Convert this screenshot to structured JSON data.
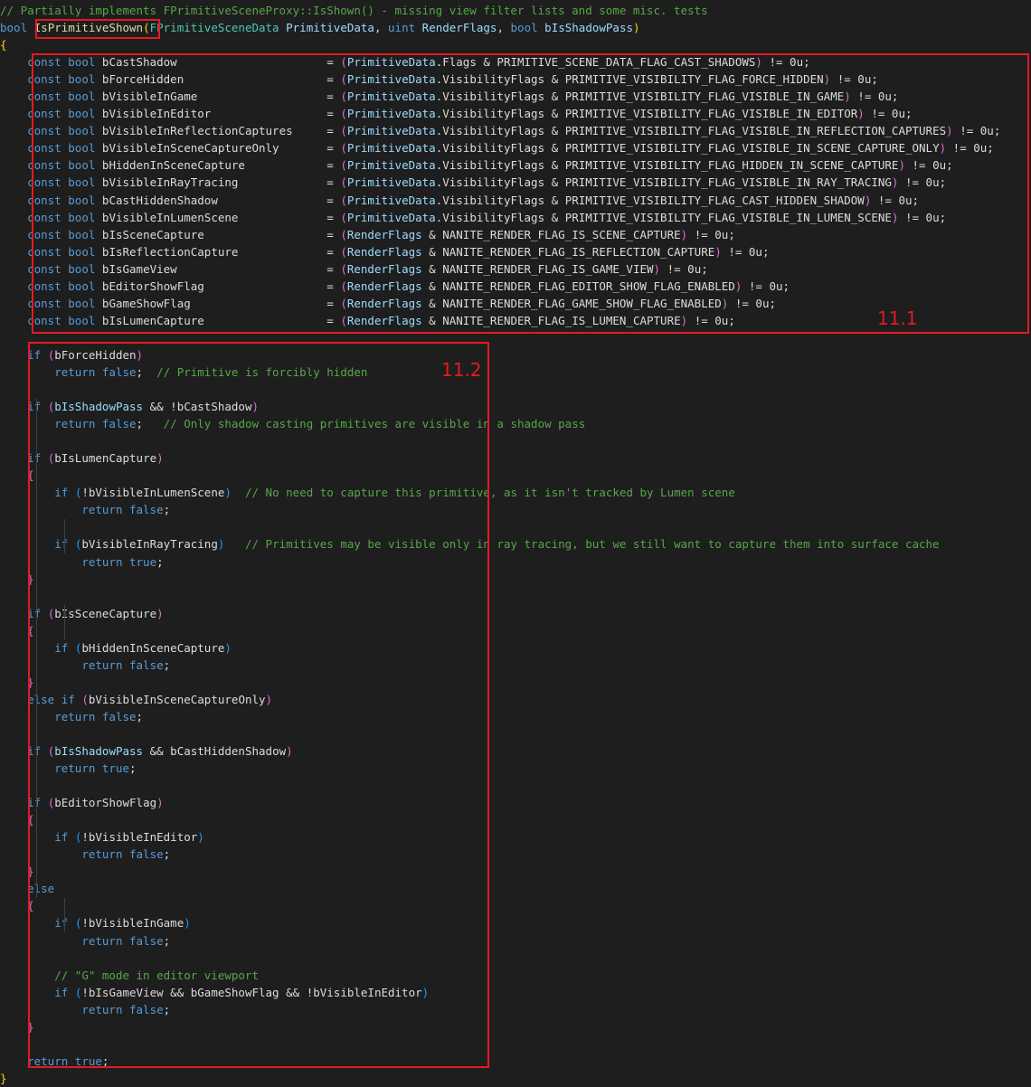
{
  "editor": {
    "comment_header": "// Partially implements FPrimitiveSceneProxy::IsShown() - missing view filter lists and some misc. tests",
    "signature": {
      "ret": "bool",
      "name": "IsPrimitiveShown",
      "p1_type": "FPrimitiveSceneData",
      "p1_name": "PrimitiveData",
      "p2_type": "uint",
      "p2_name": "RenderFlags",
      "p3_type": "bool",
      "p3_name": "bIsShadowPass"
    },
    "declarations": [
      {
        "name": "bCastShadow",
        "expr": "(PrimitiveData.Flags & PRIMITIVE_SCENE_DATA_FLAG_CAST_SHADOWS) != 0u;"
      },
      {
        "name": "bForceHidden",
        "expr": "(PrimitiveData.VisibilityFlags & PRIMITIVE_VISIBILITY_FLAG_FORCE_HIDDEN) != 0u;"
      },
      {
        "name": "bVisibleInGame",
        "expr": "(PrimitiveData.VisibilityFlags & PRIMITIVE_VISIBILITY_FLAG_VISIBLE_IN_GAME) != 0u;"
      },
      {
        "name": "bVisibleInEditor",
        "expr": "(PrimitiveData.VisibilityFlags & PRIMITIVE_VISIBILITY_FLAG_VISIBLE_IN_EDITOR) != 0u;"
      },
      {
        "name": "bVisibleInReflectionCaptures",
        "expr": "(PrimitiveData.VisibilityFlags & PRIMITIVE_VISIBILITY_FLAG_VISIBLE_IN_REFLECTION_CAPTURES) != 0u;"
      },
      {
        "name": "bVisibleInSceneCaptureOnly",
        "expr": "(PrimitiveData.VisibilityFlags & PRIMITIVE_VISIBILITY_FLAG_VISIBLE_IN_SCENE_CAPTURE_ONLY) != 0u;"
      },
      {
        "name": "bHiddenInSceneCapture",
        "expr": "(PrimitiveData.VisibilityFlags & PRIMITIVE_VISIBILITY_FLAG_HIDDEN_IN_SCENE_CAPTURE) != 0u;"
      },
      {
        "name": "bVisibleInRayTracing",
        "expr": "(PrimitiveData.VisibilityFlags & PRIMITIVE_VISIBILITY_FLAG_VISIBLE_IN_RAY_TRACING) != 0u;"
      },
      {
        "name": "bCastHiddenShadow",
        "expr": "(PrimitiveData.VisibilityFlags & PRIMITIVE_VISIBILITY_FLAG_CAST_HIDDEN_SHADOW) != 0u;"
      },
      {
        "name": "bVisibleInLumenScene",
        "expr": "(PrimitiveData.VisibilityFlags & PRIMITIVE_VISIBILITY_FLAG_VISIBLE_IN_LUMEN_SCENE) != 0u;"
      },
      {
        "name": "bIsSceneCapture",
        "expr": "(RenderFlags & NANITE_RENDER_FLAG_IS_SCENE_CAPTURE) != 0u;"
      },
      {
        "name": "bIsReflectionCapture",
        "expr": "(RenderFlags & NANITE_RENDER_FLAG_IS_REFLECTION_CAPTURE) != 0u;"
      },
      {
        "name": "bIsGameView",
        "expr": "(RenderFlags & NANITE_RENDER_FLAG_IS_GAME_VIEW) != 0u;"
      },
      {
        "name": "bEditorShowFlag",
        "expr": "(RenderFlags & NANITE_RENDER_FLAG_EDITOR_SHOW_FLAG_ENABLED) != 0u;"
      },
      {
        "name": "bGameShowFlag",
        "expr": "(RenderFlags & NANITE_RENDER_FLAG_GAME_SHOW_FLAG_ENABLED) != 0u;"
      },
      {
        "name": "bIsLumenCapture",
        "expr": "(RenderFlags & NANITE_RENDER_FLAG_IS_LUMEN_CAPTURE) != 0u;"
      }
    ],
    "body_lines": [
      "if (bForceHidden)",
      "return false;  // Primitive is forcibly hidden",
      "",
      "if (bIsShadowPass && !bCastShadow)",
      "return false;   // Only shadow casting primitives are visible in a shadow pass",
      "",
      "if (bIsLumenCapture)",
      "{",
      "if (!bVisibleInLumenScene)  // No need to capture this primitive, as it isn't tracked by Lumen scene",
      "return false;",
      "",
      "if (bVisibleInRayTracing)   // Primitives may be visible only in ray tracing, but we still want to capture them into surface cache",
      "return true;",
      "}",
      "",
      "if (bIsSceneCapture)",
      "{",
      "if (bHiddenInSceneCapture)",
      "return false;",
      "}",
      "else if (bVisibleInSceneCaptureOnly)",
      "return false;",
      "",
      "if (bIsShadowPass && bCastHiddenShadow)",
      "return true;",
      "",
      "if (bEditorShowFlag)",
      "{",
      "if (!bVisibleInEditor)",
      "return false;",
      "}",
      "else",
      "{",
      "if (!bVisibleInGame)",
      "return false;",
      "",
      "// \"G\" mode in editor viewport",
      "if (!bIsGameView && bGameShowFlag && !bVisibleInEditor)",
      "return false;",
      "}",
      "",
      "return true;"
    ],
    "brace_open": "{",
    "brace_close": "}"
  },
  "annotations": {
    "box1_label": "11.1",
    "box2_label": "11.2",
    "color": "#e51a22"
  },
  "syntax_colors": {
    "keyword": "#569cd6",
    "comment": "#57a64a",
    "function": "#dcdcaa",
    "type": "#4ec9b0",
    "default_text": "#dcdcdc",
    "background": "#1e1e1e"
  }
}
